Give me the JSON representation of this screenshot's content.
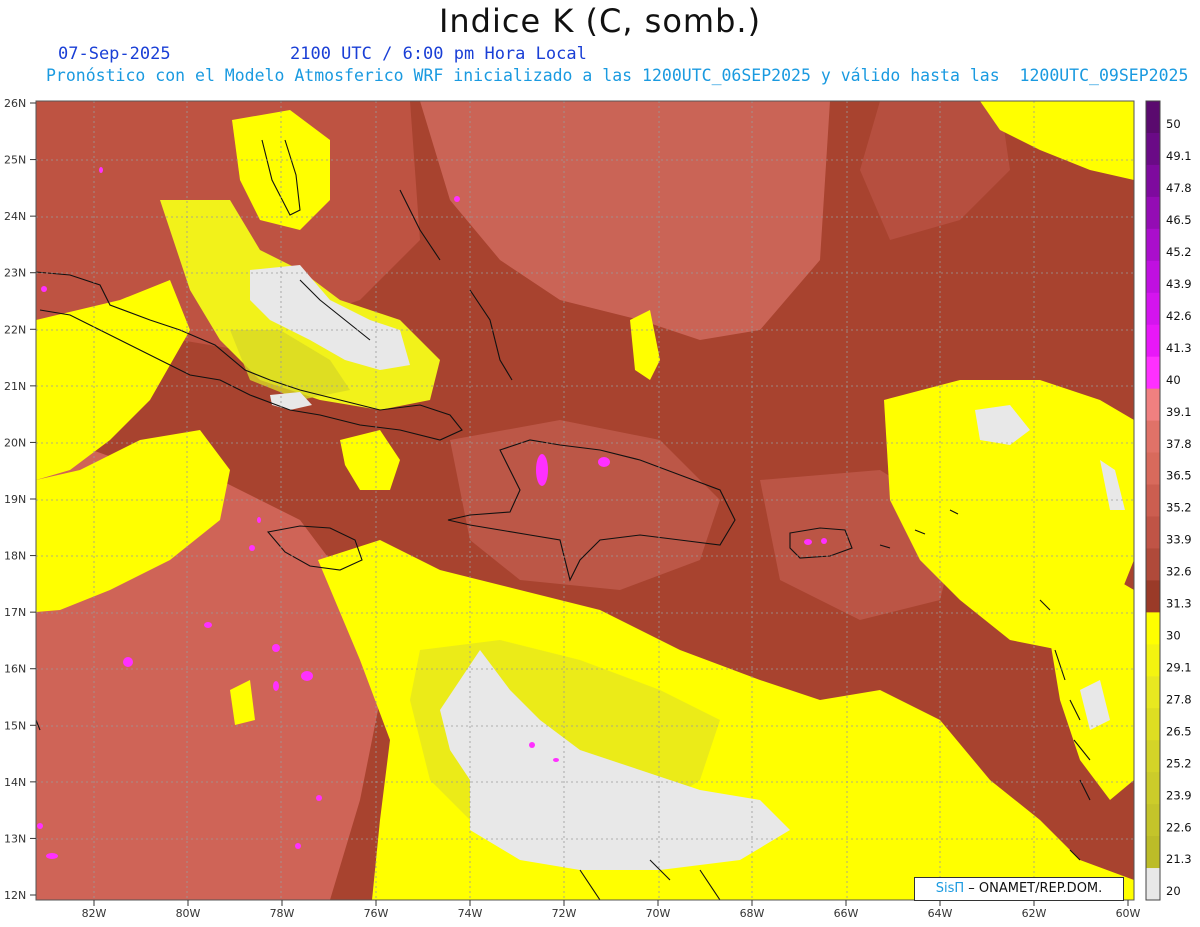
{
  "header": {
    "title": "Indice K (C, somb.)",
    "date": "07-Sep-2025",
    "time": "2100 UTC / 6:00 pm Hora Local",
    "description": "Pronóstico con el Modelo Atmosferico WRF inicializado a las 1200UTC_06SEP2025 y válido hasta las  1200UTC_09SEP2025"
  },
  "map": {
    "lat_labels": [
      "26N",
      "25N",
      "24N",
      "23N",
      "22N",
      "21N",
      "20N",
      "19N",
      "18N",
      "17N",
      "16N",
      "15N",
      "14N",
      "13N",
      "12N"
    ],
    "lon_labels": [
      "82W",
      "80W",
      "78W",
      "76W",
      "74W",
      "72W",
      "70W",
      "68W",
      "66W",
      "64W",
      "62W",
      "60W"
    ],
    "extent": {
      "lon_min": -83.2,
      "lon_max": -60,
      "lat_min": 12,
      "lat_max": 26
    }
  },
  "colorbar": {
    "labels": [
      "50",
      "49.1",
      "47.8",
      "46.5",
      "45.2",
      "43.9",
      "42.6",
      "41.3",
      "40",
      "39.1",
      "37.8",
      "36.5",
      "35.2",
      "33.9",
      "32.6",
      "31.3",
      "30",
      "29.1",
      "27.8",
      "26.5",
      "25.2",
      "23.9",
      "22.6",
      "21.3",
      "20"
    ],
    "colors": [
      "#5a0a6e",
      "#6a0a86",
      "#7e0a9e",
      "#940cb4",
      "#aa0ecc",
      "#c010e0",
      "#d414ee",
      "#e818f8",
      "#ff30ff",
      "#f08080",
      "#e07268",
      "#d86a5c",
      "#cc5e50",
      "#c05446",
      "#b04a3a",
      "#9a3a28",
      "#ffff00",
      "#f4f410",
      "#e8e820",
      "#dede22",
      "#d4d428",
      "#cccc2a",
      "#c4c42a",
      "#bcbc28",
      "#e8e8e8"
    ],
    "accent_colors": {
      "low": "#e8e8e8",
      "yellow": "#ffff00",
      "brown": "#9a3a28",
      "salmon": "#d86a5c",
      "magenta": "#ff30ff"
    }
  },
  "credit": {
    "brand": "SisΠ",
    "text": " – ONAMET/REP.DOM."
  }
}
